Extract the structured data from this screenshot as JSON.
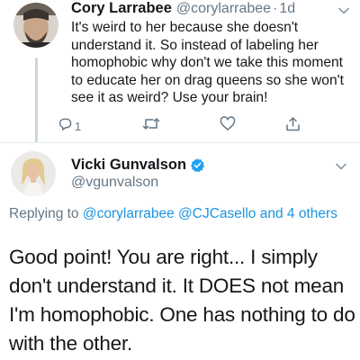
{
  "tweet1": {
    "name": "Cory Larrabee",
    "handle": "@corylarrabee",
    "separator": "·",
    "time": "1d",
    "text": "It's weird to her because she doesn't understand it. So instead of labeling her homophobic why don't we take this moment to educate her on drag queens so she won't see it as weird? Use your brain!",
    "reply_count": "1",
    "icons": [
      "reply-icon",
      "retweet-icon",
      "like-icon",
      "share-icon",
      "chevron-down-icon"
    ]
  },
  "tweet2": {
    "name": "Vicki Gunvalson",
    "handle": "@vgunvalson",
    "verified": true,
    "replying_prefix": "Replying to",
    "replying_to": "@corylarrabee @CJCasello and 4 others",
    "text": "Good point!  You are right... I simply don't understand it.  It DOES not mean I'm homophobic.  One has nothing to do with the other."
  },
  "colors": {
    "link": "#1b95e0",
    "muted": "#657786",
    "text": "#14171a",
    "verified": "#1da1f2"
  }
}
